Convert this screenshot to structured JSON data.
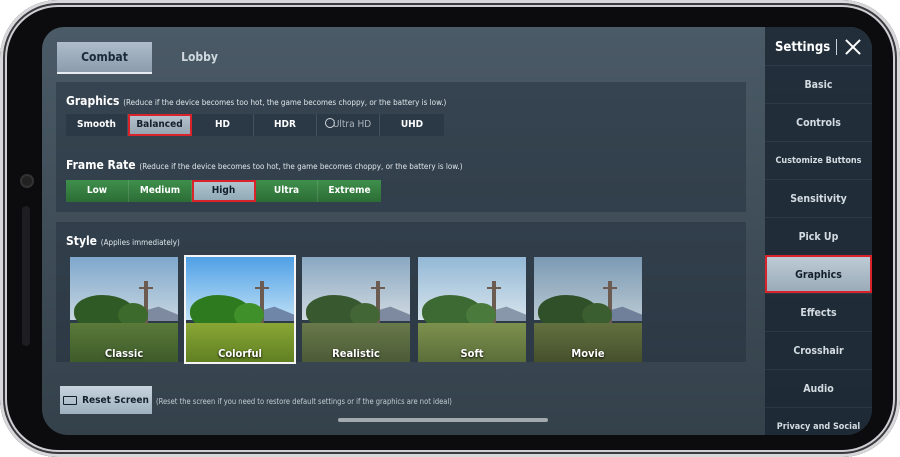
{
  "tabs": [
    {
      "label": "Combat"
    },
    {
      "label": "Lobby"
    }
  ],
  "graphics": {
    "title": "Graphics",
    "note": "(Reduce if the device becomes too hot, the game becomes choppy, or the battery is low.)",
    "options": [
      "Smooth",
      "Balanced",
      "HD",
      "HDR",
      "Ultra HD",
      "UHD"
    ],
    "selected": "Balanced"
  },
  "frame_rate": {
    "title": "Frame Rate",
    "note": "(Reduce if the device becomes too hot, the game becomes choppy, or the battery is low.)",
    "options": [
      "Low",
      "Medium",
      "High",
      "Ultra",
      "Extreme"
    ],
    "selected": "High"
  },
  "style": {
    "title": "Style",
    "note": "(Applies immediately)",
    "options": [
      "Classic",
      "Colorful",
      "Realistic",
      "Soft",
      "Movie"
    ],
    "selected": "Colorful"
  },
  "reset": {
    "label": "Reset Screen",
    "note": "(Reset the screen if you need to restore default settings or if the graphics are not ideal)"
  },
  "sidebar": {
    "title": "Settings",
    "items": [
      {
        "label": "Basic"
      },
      {
        "label": "Controls"
      },
      {
        "label": "Customize Buttons"
      },
      {
        "label": "Sensitivity"
      },
      {
        "label": "Pick Up"
      },
      {
        "label": "Graphics"
      },
      {
        "label": "Effects"
      },
      {
        "label": "Crosshair"
      },
      {
        "label": "Audio"
      },
      {
        "label": "Privacy and Social"
      }
    ],
    "active": "Graphics"
  },
  "colors": {
    "selected_outline": "#d8232a",
    "frame_rate_bar": "#3f8f4c",
    "graphics_bar": "#2b3846"
  }
}
